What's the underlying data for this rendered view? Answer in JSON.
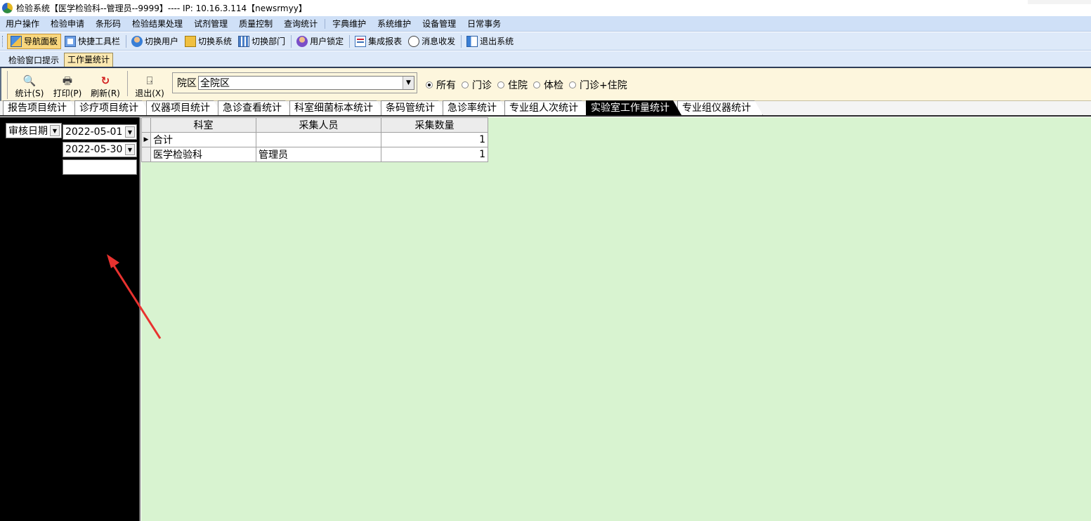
{
  "titlebar": {
    "title": "检验系统【医学检验科--管理员--9999】---- IP:  10.16.3.114【newsrmyy】"
  },
  "menubar": {
    "items": [
      "用户操作",
      "检验申请",
      "条形码",
      "检验结果处理",
      "试剂管理",
      "质量控制",
      "查询统计",
      "字典维护",
      "系统维护",
      "设备管理",
      "日常事务"
    ]
  },
  "toolbar": {
    "items": [
      {
        "label": "导航面板",
        "icon": "nav-panel-icon",
        "active": true
      },
      {
        "label": "快捷工具栏",
        "icon": "quick-toolbar-icon"
      },
      {
        "label": "切换用户",
        "icon": "switch-user-icon"
      },
      {
        "label": "切换系统",
        "icon": "switch-system-icon"
      },
      {
        "label": "切换部门",
        "icon": "switch-dept-icon"
      },
      {
        "label": "用户锁定",
        "icon": "user-lock-icon"
      },
      {
        "label": "集成报表",
        "icon": "report-icon"
      },
      {
        "label": "消息收发",
        "icon": "message-icon"
      },
      {
        "label": "退出系统",
        "icon": "exit-system-icon"
      }
    ]
  },
  "window_tabs": [
    "检验窗口提示",
    "工作量统计"
  ],
  "actions": {
    "stat": "统计(S)",
    "print": "打印(P)",
    "refresh": "刷新(R)",
    "exit": "退出(X)"
  },
  "campus": {
    "label": "院区",
    "value": "全院区"
  },
  "patient_types": {
    "options": [
      "所有",
      "门诊",
      "住院",
      "体检",
      "门诊+住院"
    ],
    "selected": "所有"
  },
  "report_tabs": {
    "items": [
      "报告项目统计",
      "诊疗项目统计",
      "仪器项目统计",
      "急诊查看统计",
      "科室细菌标本统计",
      "条码管统计",
      "急诊率统计",
      "专业组人次统计",
      "实验室工作量统计",
      "专业组仪器统计"
    ],
    "active": "实验室工作量统计"
  },
  "filters": {
    "date_type": "审核日期",
    "date_from": "2022-05-01",
    "date_to": "2022-05-30",
    "extra": ""
  },
  "grid": {
    "columns": [
      "科室",
      "采集人员",
      "采集数量"
    ],
    "rows": [
      {
        "dept": "合计",
        "collector": "",
        "count": "1"
      },
      {
        "dept": "医学检验科",
        "collector": "管理员",
        "count": "1"
      }
    ]
  },
  "colors": {
    "menubar_bg": "#cfe0f7",
    "toolbar_bg": "#dde9f9",
    "action_panel_bg": "#fdf6dd",
    "left_panel_bg": "#000000",
    "data_area_bg": "#d8f3d0",
    "active_tab_bg": "#000000",
    "annotation_arrow": "#e8322f"
  }
}
